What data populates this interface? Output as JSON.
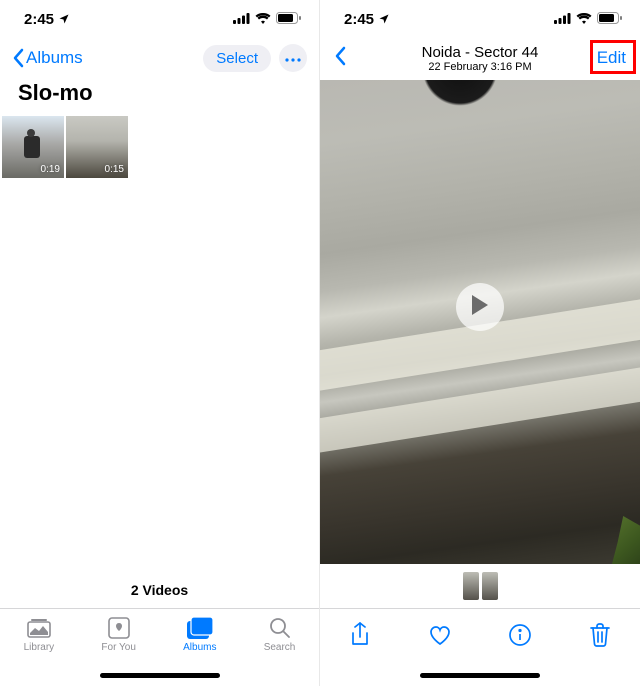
{
  "status": {
    "time": "2:45",
    "location_icon": "location-arrow-icon"
  },
  "left": {
    "back_label": "Albums",
    "select_label": "Select",
    "album_title": "Slo-mo",
    "thumbs": [
      {
        "duration": "0:19"
      },
      {
        "duration": "0:15"
      }
    ],
    "footer_count": "2 Videos",
    "tabs": [
      {
        "name": "library",
        "label": "Library"
      },
      {
        "name": "for-you",
        "label": "For You"
      },
      {
        "name": "albums",
        "label": "Albums",
        "active": true
      },
      {
        "name": "search",
        "label": "Search"
      }
    ]
  },
  "right": {
    "title": "Noida - Sector 44",
    "subtitle": "22 February  3:16 PM",
    "edit_label": "Edit",
    "toolbar": {
      "share": "share-icon",
      "favorite": "heart-icon",
      "info": "info-icon",
      "delete": "trash-icon"
    }
  }
}
